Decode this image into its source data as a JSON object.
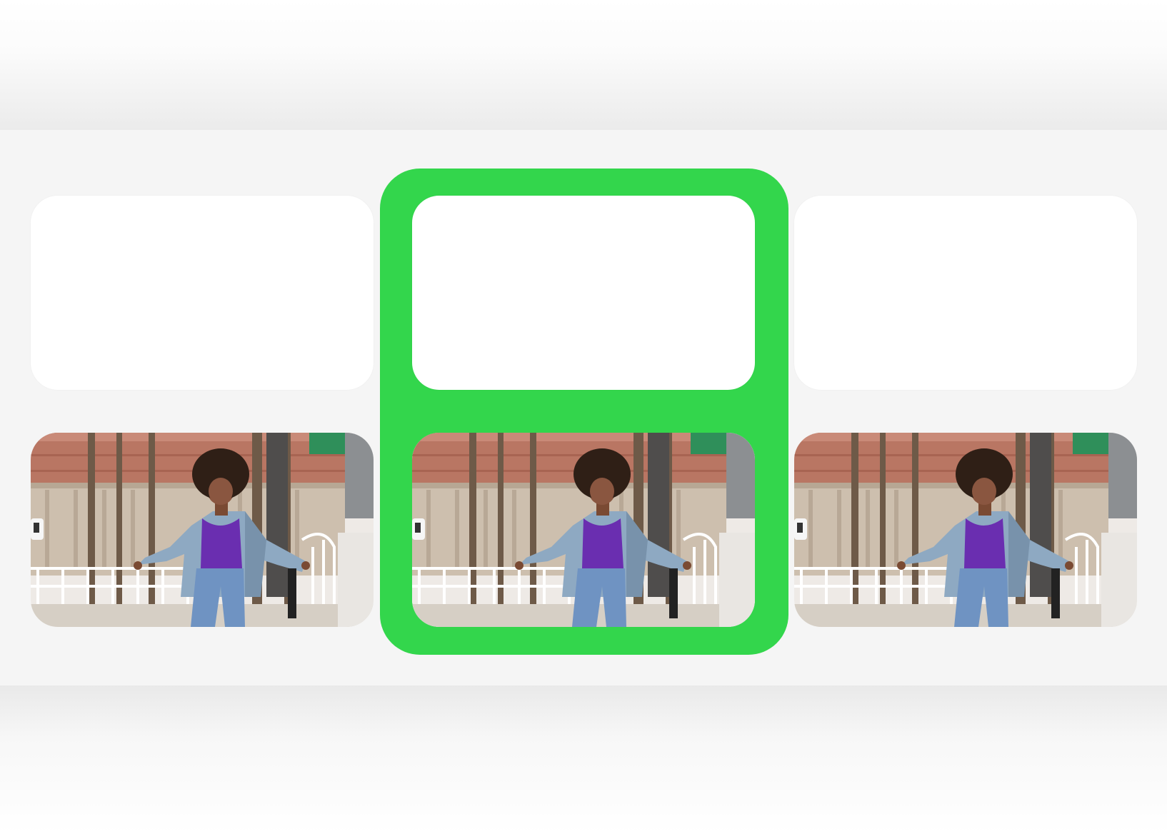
{
  "layout_options": [
    {
      "name": "left-option",
      "cards": [
        {
          "kind": "blank"
        },
        {
          "kind": "photo",
          "subject": "woman-in-denim-jacket-photo"
        }
      ]
    },
    {
      "name": "center-option",
      "selected": true,
      "cards": [
        {
          "kind": "blank"
        },
        {
          "kind": "photo",
          "subject": "woman-in-denim-jacket-photo"
        }
      ]
    },
    {
      "name": "right-option",
      "cards": [
        {
          "kind": "blank"
        },
        {
          "kind": "photo",
          "subject": "woman-in-denim-jacket-photo"
        }
      ]
    }
  ],
  "colors": {
    "selection": "#33d64c",
    "band": "#f5f5f5",
    "card": "#ffffff",
    "shirt": "#6b2fb0",
    "jacket": "#8aa6bf",
    "wall": "#b56f5c"
  }
}
